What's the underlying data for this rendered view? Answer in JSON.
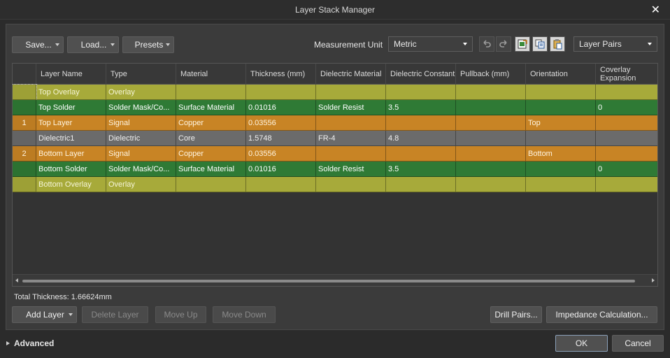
{
  "window": {
    "title": "Layer Stack Manager"
  },
  "toolbar": {
    "save_label": "Save...",
    "load_label": "Load...",
    "presets_label": "Presets",
    "measurement_label": "Measurement Unit",
    "measurement_value": "Metric",
    "view_value": "Layer Pairs"
  },
  "grid": {
    "headers": [
      "",
      "Layer Name",
      "Type",
      "Material",
      "Thickness (mm)",
      "Dielectric Material",
      "Dielectric Constant",
      "Pullback (mm)",
      "Orientation",
      "Coverlay Expansion"
    ],
    "rows": [
      {
        "num": "",
        "name": "Top Overlay",
        "type": "Overlay",
        "material": "",
        "thickness": "",
        "dmat": "",
        "dconst": "",
        "pullback": "",
        "orient": "",
        "coverlay": "",
        "color": "#a7aa3a",
        "text": "#f5f5d8"
      },
      {
        "num": "",
        "name": "Top Solder",
        "type": "Solder Mask/Co...",
        "material": "Surface Material",
        "thickness": "0.01016",
        "dmat": "Solder Resist",
        "dconst": "3.5",
        "pullback": "",
        "orient": "",
        "coverlay": "0",
        "color": "#2f7a35",
        "text": "#ffffff"
      },
      {
        "num": "1",
        "name": "Top Layer",
        "type": "Signal",
        "material": "Copper",
        "thickness": "0.03556",
        "dmat": "",
        "dconst": "",
        "pullback": "",
        "orient": "Top",
        "coverlay": "",
        "color": "#c88425",
        "text": "#fff4e0"
      },
      {
        "num": "",
        "name": "Dielectric1",
        "type": "Dielectric",
        "material": "Core",
        "thickness": "1.5748",
        "dmat": "FR-4",
        "dconst": "4.8",
        "pullback": "",
        "orient": "",
        "coverlay": "",
        "color": "#6b6b6b",
        "text": "#f0f0f0"
      },
      {
        "num": "2",
        "name": "Bottom Layer",
        "type": "Signal",
        "material": "Copper",
        "thickness": "0.03556",
        "dmat": "",
        "dconst": "",
        "pullback": "",
        "orient": "Bottom",
        "coverlay": "",
        "color": "#c88425",
        "text": "#fff4e0"
      },
      {
        "num": "",
        "name": "Bottom Solder",
        "type": "Solder Mask/Co...",
        "material": "Surface Material",
        "thickness": "0.01016",
        "dmat": "Solder Resist",
        "dconst": "3.5",
        "pullback": "",
        "orient": "",
        "coverlay": "0",
        "color": "#2f7a35",
        "text": "#ffffff"
      },
      {
        "num": "",
        "name": "Bottom Overlay",
        "type": "Overlay",
        "material": "",
        "thickness": "",
        "dmat": "",
        "dconst": "",
        "pullback": "",
        "orient": "",
        "coverlay": "",
        "color": "#a7aa3a",
        "text": "#f5f5d8"
      }
    ]
  },
  "summary": {
    "total_thickness": "Total Thickness: 1.66624mm"
  },
  "actions": {
    "add_layer": "Add Layer",
    "delete_layer": "Delete Layer",
    "move_up": "Move Up",
    "move_down": "Move Down",
    "drill_pairs": "Drill Pairs...",
    "impedance": "Impedance Calculation..."
  },
  "footer": {
    "advanced": "Advanced",
    "ok": "OK",
    "cancel": "Cancel"
  },
  "icons": [
    "undo-icon",
    "redo-icon",
    "export-icon",
    "copy-icon",
    "paste-icon",
    "close-icon"
  ]
}
